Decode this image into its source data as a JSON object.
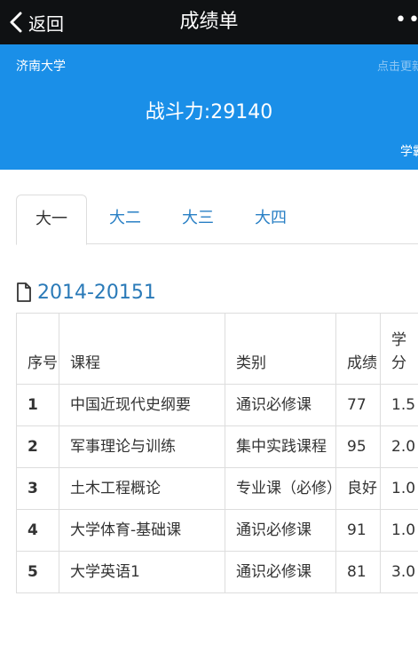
{
  "nav": {
    "back_label": "返回",
    "title": "成绩单",
    "more_label": "••"
  },
  "banner": {
    "school": "济南大学",
    "top_right_link": "点击更新",
    "power": "战斗力:29140",
    "bottom_right_link": "学霸"
  },
  "tabs": [
    {
      "label": "大一",
      "active": true
    },
    {
      "label": "大二",
      "active": false
    },
    {
      "label": "大三",
      "active": false
    },
    {
      "label": "大四",
      "active": false
    }
  ],
  "term": {
    "label": "2014-20151"
  },
  "table": {
    "headers": {
      "index": "序号",
      "course": "课程",
      "category": "类别",
      "score": "成绩",
      "credit": "学分"
    },
    "rows": [
      {
        "index": "1",
        "course": "中国近现代史纲要",
        "category": "通识必修课",
        "score": "77",
        "credit": "1.5"
      },
      {
        "index": "2",
        "course": "军事理论与训练",
        "category": "集中实践课程",
        "score": "95",
        "credit": "2.0"
      },
      {
        "index": "3",
        "course": "土木工程概论",
        "category": "专业课（必修）",
        "score": "良好",
        "credit": "1.0"
      },
      {
        "index": "4",
        "course": "大学体育-基础课",
        "category": "通识必修课",
        "score": "91",
        "credit": "1.0"
      },
      {
        "index": "5",
        "course": "大学英语1",
        "category": "通识必修课",
        "score": "81",
        "credit": "3.0"
      }
    ]
  },
  "colors": {
    "navbar": "#0f1113",
    "banner": "#1a8fe8",
    "link": "#2a80c5"
  }
}
